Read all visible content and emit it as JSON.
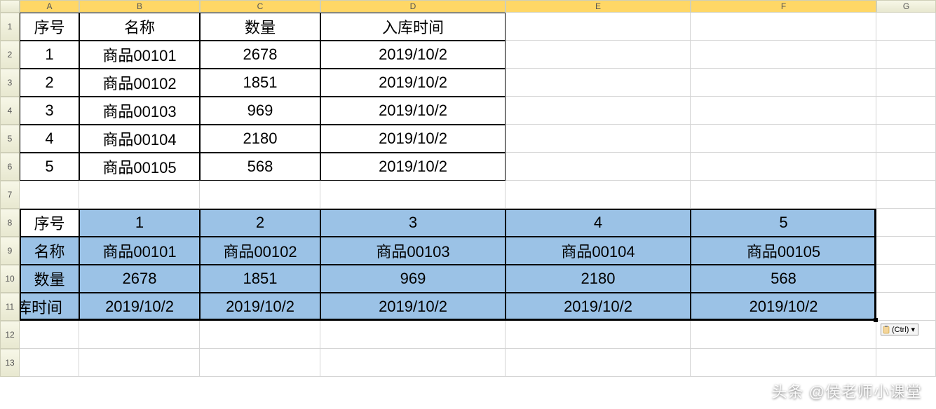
{
  "columns": [
    "A",
    "B",
    "C",
    "D",
    "E",
    "F",
    "G"
  ],
  "row_count": 13,
  "table1": {
    "headers": [
      "序号",
      "名称",
      "数量",
      "入库时间"
    ],
    "rows": [
      {
        "no": "1",
        "name": "商品00101",
        "qty": "2678",
        "date": "2019/10/2"
      },
      {
        "no": "2",
        "name": "商品00102",
        "qty": "1851",
        "date": "2019/10/2"
      },
      {
        "no": "3",
        "name": "商品00103",
        "qty": "969",
        "date": "2019/10/2"
      },
      {
        "no": "4",
        "name": "商品00104",
        "qty": "2180",
        "date": "2019/10/2"
      },
      {
        "no": "5",
        "name": "商品00105",
        "qty": "568",
        "date": "2019/10/2"
      }
    ]
  },
  "table2": {
    "row_labels": [
      "序号",
      "名称",
      "数量",
      "入库时间"
    ],
    "cols": [
      {
        "no": "1",
        "name": "商品00101",
        "qty": "2678",
        "date": "2019/10/2"
      },
      {
        "no": "2",
        "name": "商品00102",
        "qty": "1851",
        "date": "2019/10/2"
      },
      {
        "no": "3",
        "name": "商品00103",
        "qty": "969",
        "date": "2019/10/2"
      },
      {
        "no": "4",
        "name": "商品00104",
        "qty": "2180",
        "date": "2019/10/2"
      },
      {
        "no": "5",
        "name": "商品00105",
        "qty": "568",
        "date": "2019/10/2"
      }
    ],
    "row11_label_truncated": "入库时间"
  },
  "ctrl_tag": "(Ctrl) ▾",
  "watermark": "头条 @侯老师小课堂"
}
